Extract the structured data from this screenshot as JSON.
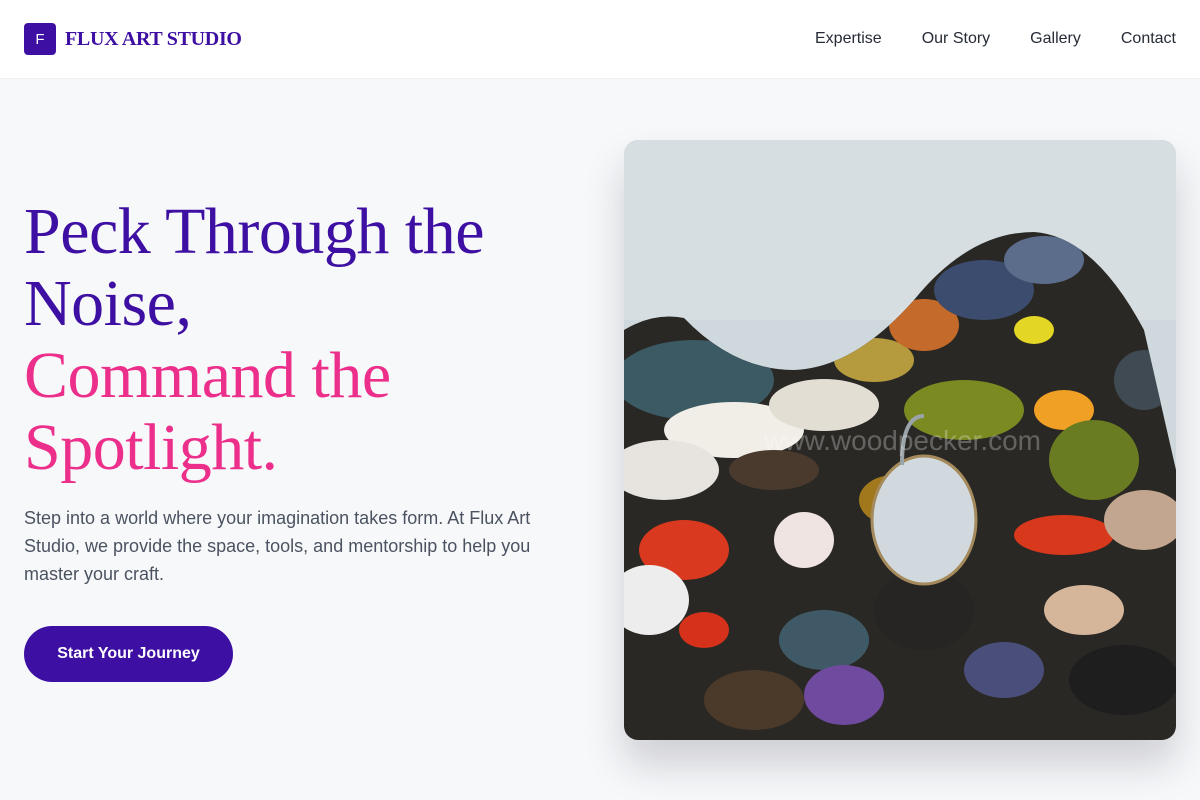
{
  "brand": {
    "logo_letter": "F",
    "name": "FLUX ART STUDIO"
  },
  "nav": {
    "items": [
      "Expertise",
      "Our Story",
      "Gallery",
      "Contact"
    ]
  },
  "hero": {
    "headline_line1": "Peck Through the",
    "headline_line2": "Noise,",
    "headline_line3": "Command the",
    "headline_line4": "Spotlight.",
    "description": "Step into a world where your imagination takes form. At Flux Art Studio, we provide the space, tools, and mentorship to help you master your craft.",
    "cta_label": "Start Your Journey"
  },
  "image": {
    "subject": "paint-palette-photo",
    "watermark": "www.woodpecker.com"
  },
  "colors": {
    "primary": "#3d0fa3",
    "accent": "#ec2f8b",
    "background": "#f7f8fa",
    "body_text": "#4b5361"
  }
}
